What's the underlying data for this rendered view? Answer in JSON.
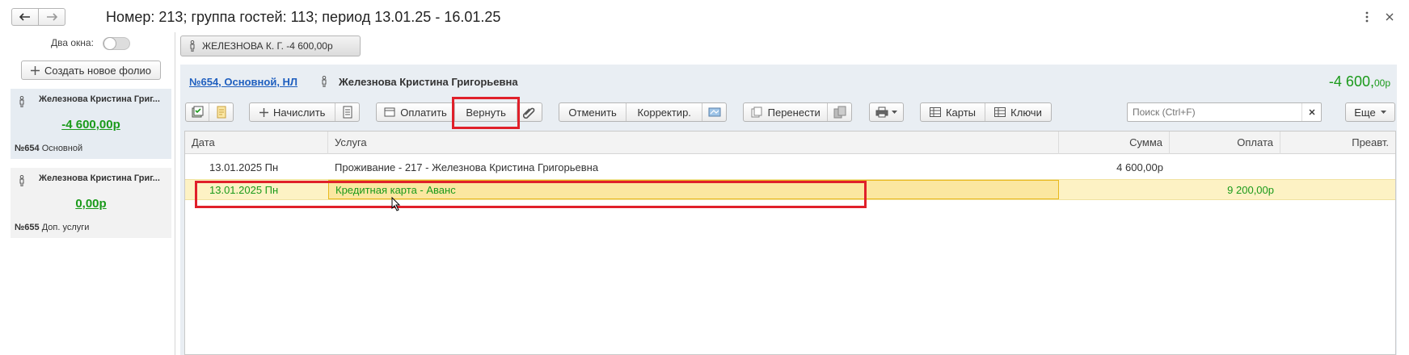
{
  "window": {
    "title": "Номер: 213; группа гостей: 113; период 13.01.25 - 16.01.25"
  },
  "left": {
    "two_windows_label": "Два окна:",
    "create_folio_label": "Создать новое фолио",
    "folios": [
      {
        "name": "Железнова Кристина Григ...",
        "amount": "-4 600,00р",
        "number": "№654",
        "type": "Основной"
      },
      {
        "name": "Железнова Кристина Григ...",
        "amount": "0,00р",
        "number": "№655",
        "type": "Доп. услуги"
      }
    ]
  },
  "guest_tab": {
    "label": "ЖЕЛЕЗНОВА К. Г. -4 600,00р"
  },
  "folio_header": {
    "link": "№654, Основной, НЛ",
    "guest_name": "Железнова Кристина Григорьевна",
    "balance_main": "-4 600,",
    "balance_cents": "00р"
  },
  "toolbar": {
    "charge_label": "Начислить",
    "pay_label": "Оплатить",
    "refund_label": "Вернуть",
    "cancel_label": "Отменить",
    "correct_label": "Корректир.",
    "transfer_label": "Перенести",
    "cards_label": "Карты",
    "keys_label": "Ключи",
    "search_placeholder": "Поиск (Ctrl+F)",
    "more_label": "Еще"
  },
  "table": {
    "headers": {
      "date": "Дата",
      "service": "Услуга",
      "sum": "Сумма",
      "payment": "Оплата",
      "preavt": "Преавт."
    },
    "rows": [
      {
        "date": "13.01.2025 Пн",
        "service": "Проживание - 217 - Железнова Кристина Григорьевна",
        "sum": "4 600,00р",
        "payment": "",
        "preavt": ""
      },
      {
        "date": "13.01.2025 Пн",
        "service": "Кредитная карта - Аванс",
        "sum": "",
        "payment": "9 200,00р",
        "preavt": ""
      }
    ]
  },
  "colors": {
    "accent_green": "#1a9a1a",
    "link_blue": "#1f5fbf",
    "highlight_red": "#e0202a",
    "selected_row": "#fdf2c4"
  }
}
